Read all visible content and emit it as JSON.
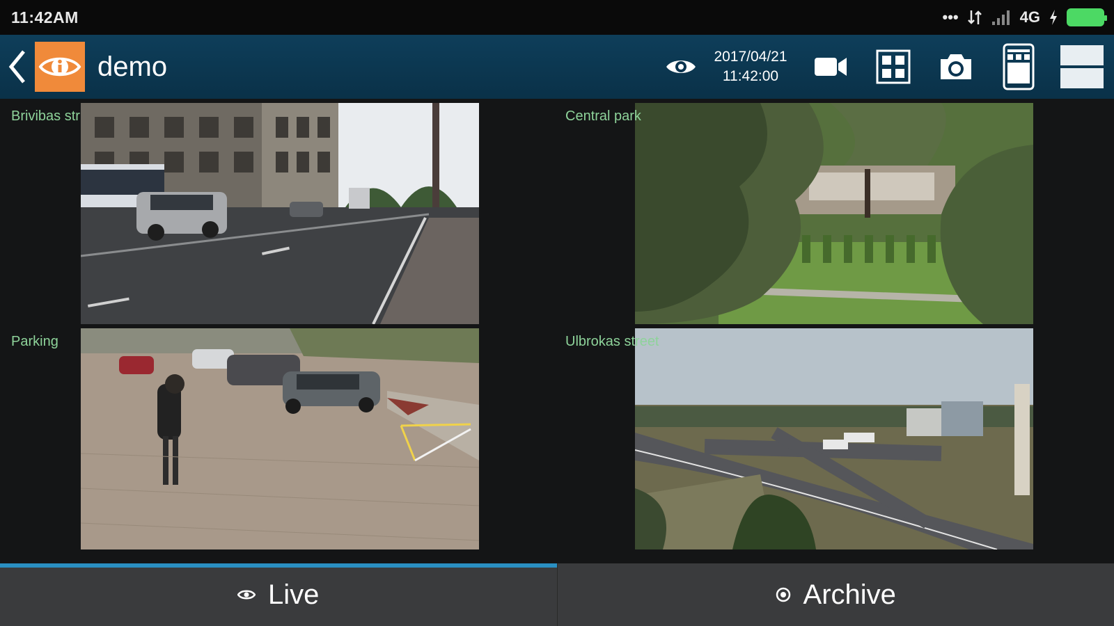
{
  "status_bar": {
    "time": "11:42AM",
    "network": "4G"
  },
  "toolbar": {
    "title": "demo",
    "date": "2017/04/21",
    "time": "11:42:00"
  },
  "cameras": [
    {
      "label": "Brivibas str"
    },
    {
      "label": "Central park"
    },
    {
      "label": "Parking"
    },
    {
      "label": "Ulbrokas street"
    }
  ],
  "tabs": [
    {
      "label": "Live",
      "active": true
    },
    {
      "label": "Archive",
      "active": false
    }
  ],
  "colors": {
    "accent": "#2a8fc2",
    "logo": "#f08a3a",
    "label": "#8ed39a"
  }
}
